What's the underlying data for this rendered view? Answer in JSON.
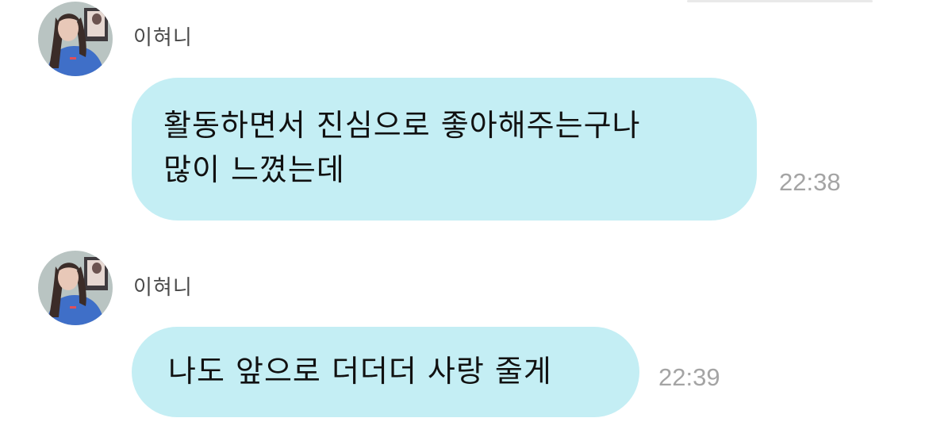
{
  "messages": [
    {
      "sender": "이혀니",
      "avatar_icon": "profile-photo",
      "lines": [
        "활동하면서 진심으로 좋아해주는구나",
        "많이 느꼈는데"
      ],
      "time": "22:38"
    },
    {
      "sender": "이혀니",
      "avatar_icon": "profile-photo",
      "lines": [
        "나도 앞으로 더더더 사랑 줄게"
      ],
      "time": "22:39"
    }
  ],
  "colors": {
    "bubble": "#c4eef4",
    "text": "#111111",
    "sender": "#4a4a4a",
    "timestamp": "#a4a4a4"
  }
}
